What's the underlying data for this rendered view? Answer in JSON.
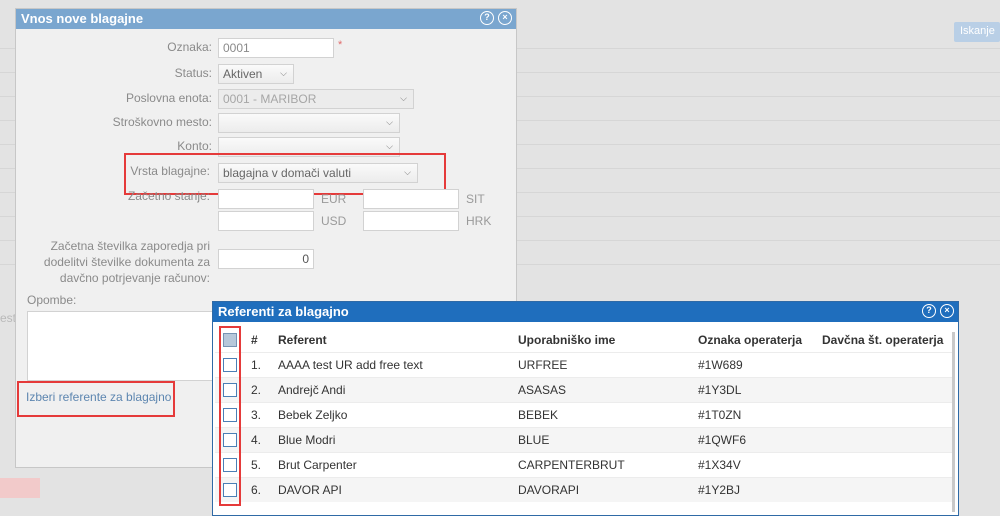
{
  "background": {
    "search_button": "Iskanje",
    "stray_text": "est"
  },
  "dialog1": {
    "title": "Vnos nove blagajne",
    "form": {
      "oznaka_label": "Oznaka:",
      "oznaka_value": "0001",
      "required_mark": "*",
      "status_label": "Status:",
      "status_value": "Aktiven",
      "poslovna_enota_label": "Poslovna enota:",
      "poslovna_enota_value": "0001 - MARIBOR",
      "stroskovno_mesto_label": "Stroškovno mesto:",
      "stroskovno_mesto_value": "",
      "konto_label": "Konto:",
      "konto_value": "",
      "vrsta_blagajne_label": "Vrsta blagajne:",
      "vrsta_blagajne_value": "blagajna v domači valuti",
      "zacetno_stanje_label": "Začetno stanje:",
      "currencies": [
        "EUR",
        "SIT",
        "USD",
        "HRK"
      ],
      "zacetna_stevilka_label_1": "Začetna številka zaporedja pri",
      "zacetna_stevilka_label_2": "dodelitvi številke dokumenta za",
      "zacetna_stevilka_label_3": "davčno potrjevanje računov:",
      "zacetna_stevilka_value": "0",
      "opombe_label": "Opombe:"
    },
    "link_select_referents": "Izberi referente za blagajno"
  },
  "dialog2": {
    "title": "Referenti za blagajno",
    "columns": [
      "#",
      "Referent",
      "Uporabniško ime",
      "Oznaka operaterja",
      "Davčna št. operaterja"
    ],
    "rows": [
      {
        "num": "1.",
        "referent": "AAAA test UR add free text",
        "username": "URFREE",
        "oznaka": "#1W689",
        "davcna": ""
      },
      {
        "num": "2.",
        "referent": "Andrejč Andi",
        "username": "ASASAS",
        "oznaka": "#1Y3DL",
        "davcna": ""
      },
      {
        "num": "3.",
        "referent": "Bebek Zeljko",
        "username": "BEBEK",
        "oznaka": "#1T0ZN",
        "davcna": ""
      },
      {
        "num": "4.",
        "referent": "Blue Modri",
        "username": "BLUE",
        "oznaka": "#1QWF6",
        "davcna": ""
      },
      {
        "num": "5.",
        "referent": "Brut Carpenter",
        "username": "CARPENTERBRUT",
        "oznaka": "#1X34V",
        "davcna": ""
      },
      {
        "num": "6.",
        "referent": "DAVOR API",
        "username": "DAVORAPI",
        "oznaka": "#1Y2BJ",
        "davcna": ""
      }
    ]
  },
  "icons": {
    "help": "?",
    "close": "×"
  },
  "colors": {
    "dialog2_title": "#1f6ebd",
    "dialog1_title": "#7aa6cf",
    "highlight": "#e53a3a"
  }
}
